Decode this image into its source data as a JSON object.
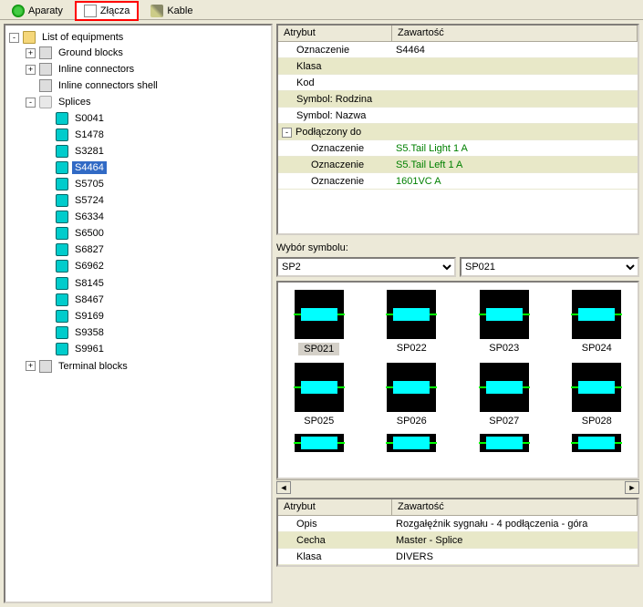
{
  "tabs": {
    "aparaty": "Aparaty",
    "zlacza": "Złącza",
    "kable": "Kable"
  },
  "tree": {
    "root": "List of equipments",
    "ground": "Ground blocks",
    "inline": "Inline connectors",
    "inlineShell": "Inline connectors shell",
    "splices": "Splices",
    "terminal": "Terminal blocks",
    "spliceItems": [
      "S0041",
      "S1478",
      "S3281",
      "S4464",
      "S5705",
      "S5724",
      "S6334",
      "S6500",
      "S6827",
      "S6962",
      "S8145",
      "S8467",
      "S9169",
      "S9358",
      "S9961"
    ],
    "selected": "S4464"
  },
  "propsTop": {
    "head1": "Atrybut",
    "head2": "Zawartość",
    "rows": [
      {
        "k": "Oznaczenie",
        "v": "S4464",
        "g": false
      },
      {
        "k": "Klasa",
        "v": "",
        "g": false,
        "stripe": true
      },
      {
        "k": "Kod",
        "v": "",
        "g": false
      },
      {
        "k": "Symbol: Rodzina",
        "v": "",
        "g": false,
        "stripe": true
      },
      {
        "k": "Symbol: Nazwa",
        "v": "",
        "g": false
      },
      {
        "k": "Podłączony do",
        "v": "",
        "g": false,
        "stripe": true,
        "exp": true
      },
      {
        "k": "Oznaczenie",
        "v": "S5.Tail Light 1    A",
        "g": true,
        "indent": true
      },
      {
        "k": "Oznaczenie",
        "v": "S5.Tail Left 1    A",
        "g": true,
        "indent": true,
        "stripe": true
      },
      {
        "k": "Oznaczenie",
        "v": "1601VC    A",
        "g": true,
        "indent": true
      }
    ]
  },
  "symbol": {
    "label": "Wybór symbolu:",
    "sel1": "SP2",
    "sel2": "SP021",
    "thumbs": [
      "SP021",
      "SP022",
      "SP023",
      "SP024",
      "SP025",
      "SP026",
      "SP027",
      "SP028"
    ],
    "selected": "SP021"
  },
  "propsBottom": {
    "head1": "Atrybut",
    "head2": "Zawartość",
    "rows": [
      {
        "k": "Opis",
        "v": "Rozgałęźnik sygnału - 4 podłączenia - góra"
      },
      {
        "k": "Cecha",
        "v": "Master - Splice",
        "stripe": true
      },
      {
        "k": "Klasa",
        "v": "DIVERS"
      }
    ]
  }
}
